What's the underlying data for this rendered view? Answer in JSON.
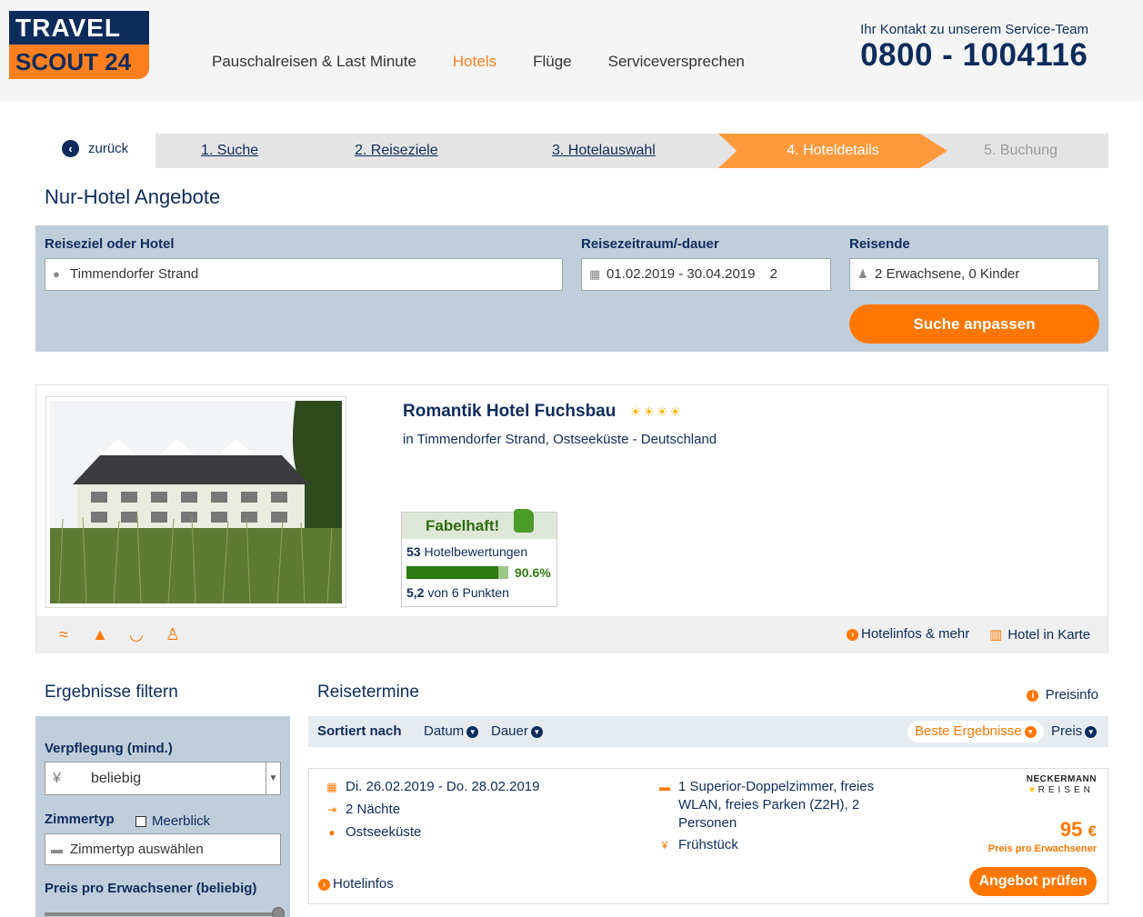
{
  "header": {
    "logo_top": "TRAVEL",
    "logo_bottom": "SCOUT 24",
    "nav": [
      "Pauschalreisen & Last Minute",
      "Hotels",
      "Flüge",
      "Serviceversprechen"
    ],
    "contact_label": "Ihr Kontakt zu unserem Service-Team",
    "phone": "0800 - 1004116"
  },
  "breadcrumb": {
    "back_label": "zurück",
    "steps": [
      "1. Suche",
      "2. Reiseziele",
      "3. Hotelauswahl",
      "4. Hoteldetails",
      "5. Buchung"
    ],
    "active_step": 4
  },
  "page_title": "Nur-Hotel Angebote",
  "search": {
    "dest_label": "Reiseziel oder Hotel",
    "dest_value": "Timmendorfer Strand",
    "date_label": "Reisezeitraum/-dauer",
    "date_value": "01.02.2019 - 30.04.2019",
    "duration_value": "2",
    "travelers_label": "Reisende",
    "travelers_value": "2 Erwachsene, 0 Kinder",
    "button": "Suche anpassen"
  },
  "hotel": {
    "name": "Romantik Hotel Fuchsbau",
    "stars": 4,
    "location": "in Timmendorfer Strand, Ostseeküste - Deutschland",
    "rating_label": "Fabelhaft!",
    "reviews_count": "53",
    "reviews_label": "Hotelbewertungen",
    "recommend_pct": "90.6%",
    "recommend_fraction": 0.906,
    "score": "5,2",
    "score_label": "von 6 Punkten",
    "amenities": [
      "swimming-icon",
      "room-service-icon",
      "spa-icon",
      "family-icon"
    ],
    "link_info": "Hotelinfos & mehr",
    "link_map": "Hotel in Karte"
  },
  "filter": {
    "title": "Ergebnisse filtern",
    "board_label": "Verpflegung (mind.)",
    "board_value": "beliebig",
    "room_label": "Zimmertyp",
    "seaview_label": "Meerblick",
    "room_placeholder": "Zimmertyp auswählen",
    "price_label": "Preis pro Erwachsener (beliebig)"
  },
  "results": {
    "title": "Reisetermine",
    "preisinfo": "Preisinfo",
    "sort_label": "Sortiert nach",
    "sort_date": "Datum",
    "sort_duration": "Dauer",
    "sort_best": "Beste Ergebnisse",
    "sort_price": "Preis",
    "offers": [
      {
        "dates": "Di. 26.02.2019 - Do. 28.02.2019",
        "nights": "2 Nächte",
        "region": "Ostseeküste",
        "room": "1 Superior-Doppelzimmer, freies WLAN, freies Parken (Z2H), 2 Personen",
        "board": "Frühstück",
        "operator_top": "NECKERMANN",
        "operator_bottom": "REISEN",
        "price": "95",
        "currency": "€",
        "price_label": "Preis pro Erwachsener",
        "button": "Angebot prüfen",
        "hotelinfos": "Hotelinfos"
      }
    ]
  },
  "colors": {
    "navy": "#0d2c5c",
    "orange": "#ff7700",
    "panel": "#c0cedb",
    "green": "#2d7a10"
  }
}
